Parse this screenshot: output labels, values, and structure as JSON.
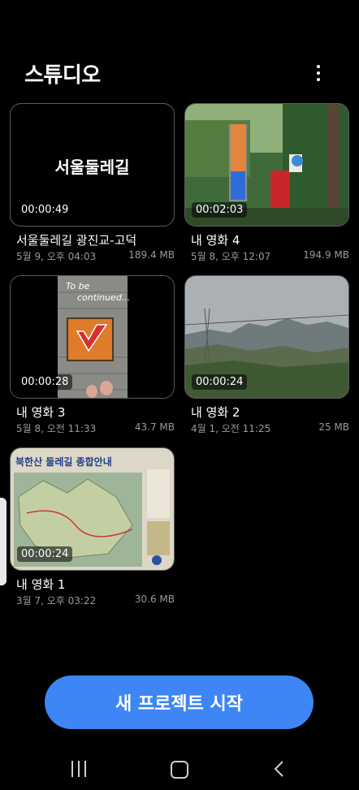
{
  "header": {
    "title": "스튜디오",
    "more_icon": "more-vertical-icon"
  },
  "projects": [
    {
      "thumb_title": "서울둘레길",
      "duration": "00:00:49",
      "name": "서울둘레길 광진교-고덕",
      "date": "5월 9, 오후 04:03",
      "size": "189.4 MB"
    },
    {
      "duration": "00:02:03",
      "name": "내 영화 4",
      "date": "5월 8, 오후 12:07",
      "size": "194.9 MB"
    },
    {
      "thumb_caption_1": "To be",
      "thumb_caption_2": "continued...",
      "duration": "00:00:28",
      "name": "내 영화 3",
      "date": "5월 8, 오전 11:33",
      "size": "43.7 MB"
    },
    {
      "duration": "00:00:24",
      "name": "내 영화 2",
      "date": "4월 1, 오전 11:25",
      "size": "25 MB"
    },
    {
      "thumb_heading": "북한산 둘레길 종합안내",
      "duration": "00:00:24",
      "name": "내 영화 1",
      "date": "3월 7, 오후 03:22",
      "size": "30.6 MB"
    }
  ],
  "actions": {
    "new_project": "새 프로젝트 시작"
  },
  "navbar": {
    "recent_icon": "recent-apps-icon",
    "home_icon": "home-icon",
    "back_icon": "back-icon"
  },
  "colors": {
    "background": "#000000",
    "accent": "#3e86f5",
    "secondary_text": "#9a9a9a"
  }
}
